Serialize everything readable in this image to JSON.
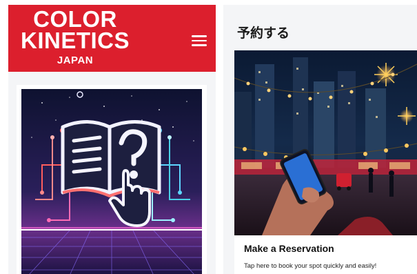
{
  "header": {
    "logo_line1": "COLOR",
    "logo_line2": "KINETICS",
    "logo_line3": "JAPAN"
  },
  "icons": {
    "menu": "hamburger-menu-icon"
  },
  "colors": {
    "brand_red": "#dc1f2d",
    "panel_bg": "#f4f5f7",
    "card_bg": "#ffffff"
  },
  "reservation": {
    "section_title": "予約する",
    "card_title": "Make a Reservation",
    "card_description": "Tap here to book your spot quickly and easily!"
  }
}
